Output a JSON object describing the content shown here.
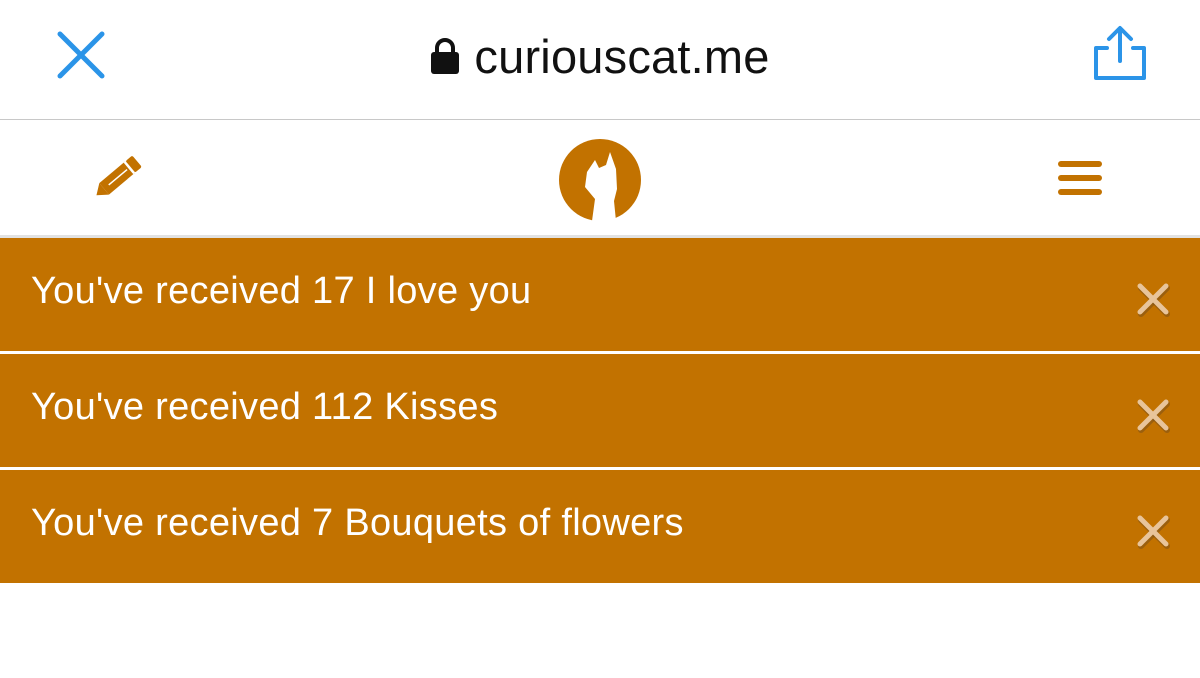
{
  "browser": {
    "url": "curiouscat.me",
    "close_icon": "close-icon",
    "lock_icon": "lock-icon",
    "share_icon": "share-icon",
    "accent_color": "#2b94e8"
  },
  "header": {
    "edit_icon": "pencil-icon",
    "logo_icon": "curiouscat-logo",
    "menu_icon": "hamburger-menu-icon",
    "brand_color": "#c27200"
  },
  "notifications": [
    {
      "text": "You've received 17 I love you",
      "dismiss_icon": "close-icon"
    },
    {
      "text": "You've received 112 Kisses",
      "dismiss_icon": "close-icon"
    },
    {
      "text": "You've received 7 Bouquets of flowers",
      "dismiss_icon": "close-icon"
    }
  ]
}
